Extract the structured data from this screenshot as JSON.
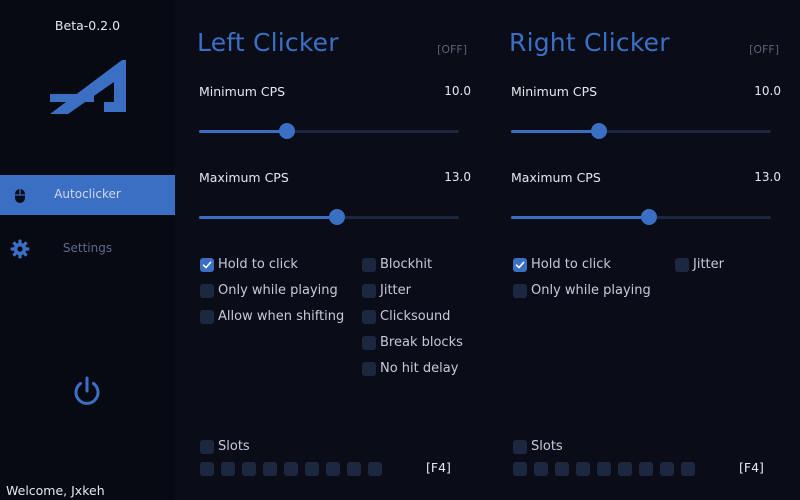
{
  "sidebar": {
    "version": "Beta-0.2.0",
    "nav": [
      {
        "label": "Autoclicker",
        "icon": "mouse-icon",
        "active": true
      },
      {
        "label": "Settings",
        "icon": "gear-icon",
        "active": false
      }
    ],
    "power_icon": "power-icon",
    "welcome": "Welcome, Jxkeh"
  },
  "left": {
    "title": "Left Clicker",
    "status": "[OFF]",
    "min_label": "Minimum CPS",
    "min_value": "10.0",
    "min_level_pct": 34,
    "max_label": "Maximum CPS",
    "max_value": "13.0",
    "max_level_pct": 53,
    "checkboxes": {
      "hold": {
        "label": "Hold to click",
        "checked": true
      },
      "only_playing": {
        "label": "Only while playing",
        "checked": false
      },
      "allow_shifting": {
        "label": "Allow when shifting",
        "checked": false
      },
      "blockhit": {
        "label": "Blockhit",
        "checked": false
      },
      "jitter": {
        "label": "Jitter",
        "checked": false
      },
      "clicksound": {
        "label": "Clicksound",
        "checked": false
      },
      "break_blocks": {
        "label": "Break blocks",
        "checked": false
      },
      "no_hit_delay": {
        "label": "No hit delay",
        "checked": false
      }
    },
    "slots_label": "Slots",
    "slot_count": 9,
    "hotkey": "[F4]"
  },
  "right": {
    "title": "Right Clicker",
    "status": "[OFF]",
    "min_label": "Minimum CPS",
    "min_value": "10.0",
    "min_level_pct": 34,
    "max_label": "Maximum CPS",
    "max_value": "13.0",
    "max_level_pct": 53,
    "checkboxes": {
      "hold": {
        "label": "Hold to click",
        "checked": true
      },
      "only_playing": {
        "label": "Only while playing",
        "checked": false
      },
      "jitter": {
        "label": "Jitter",
        "checked": false
      }
    },
    "slots_label": "Slots",
    "slot_count": 9,
    "hotkey": "[F4]"
  },
  "colors": {
    "accent": "#3b6fc4",
    "background": "#0a0d18",
    "sidebar": "#070a13",
    "checkbox_off": "#1c2740"
  }
}
